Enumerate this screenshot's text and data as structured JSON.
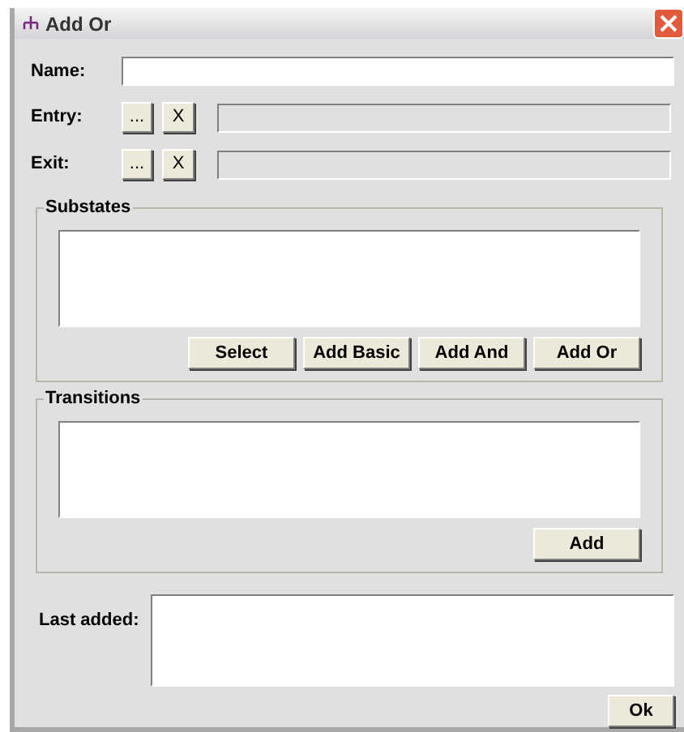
{
  "window": {
    "title": "Add Or"
  },
  "name_field": {
    "label": "Name:"
  },
  "actions": [
    {
      "label": "Entry:",
      "browse": "...",
      "clear": "X",
      "field_disabled": true
    },
    {
      "label": "Exit:",
      "browse": "...",
      "clear": "X",
      "field_disabled": true
    }
  ],
  "substates": {
    "title": "Substates",
    "buttons": [
      "Select",
      "Add Basic",
      "Add And",
      "Add Or"
    ]
  },
  "transitions": {
    "title": "Transitions",
    "buttons": [
      "Add"
    ]
  },
  "last_added": {
    "label": "Last added:"
  },
  "ok_button": "Ok"
}
